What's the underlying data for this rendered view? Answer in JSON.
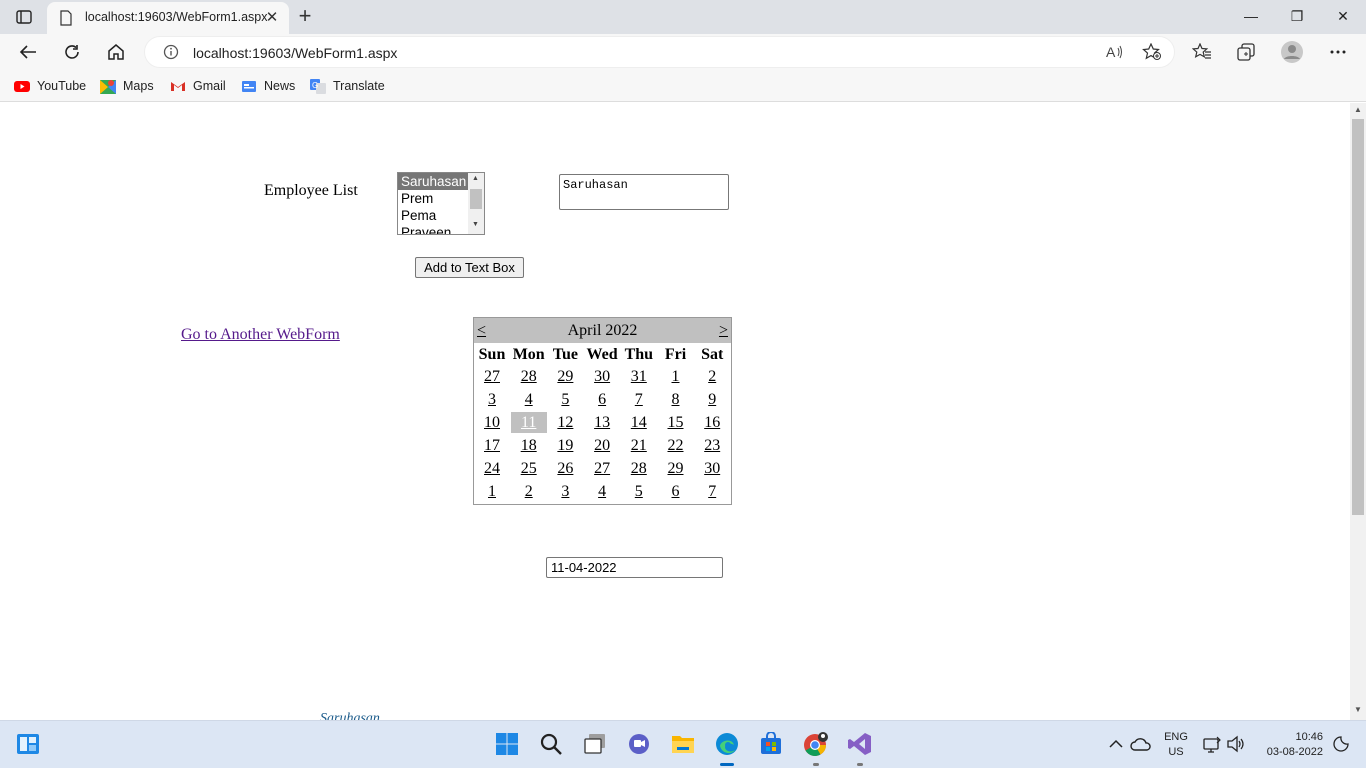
{
  "browser": {
    "tab_title": "localhost:19603/WebForm1.aspx",
    "url": "localhost:19603/WebForm1.aspx",
    "bookmarks": [
      {
        "label": "YouTube",
        "icon": "youtube-icon",
        "color": "#ff0000"
      },
      {
        "label": "Maps",
        "icon": "maps-icon",
        "color": "#34a853"
      },
      {
        "label": "Gmail",
        "icon": "gmail-icon",
        "color": "#d93025"
      },
      {
        "label": "News",
        "icon": "news-icon",
        "color": "#4285f4"
      },
      {
        "label": "Translate",
        "icon": "translate-icon",
        "color": "#4285f4"
      }
    ]
  },
  "page": {
    "employee_label": "Employee List",
    "employees": [
      "Saruhasan",
      "Prem",
      "Pema",
      "Praveen"
    ],
    "selected_employee": "Saruhasan",
    "textarea_value": "Saruhasan",
    "add_button_label": "Add to Text Box",
    "link_text": "Go to Another WebForm",
    "date_value": "11-04-2022",
    "cutoff_text": "Saruhasan"
  },
  "calendar": {
    "prev": "<",
    "next": ">",
    "title": "April 2022",
    "days_of_week": [
      "Sun",
      "Mon",
      "Tue",
      "Wed",
      "Thu",
      "Fri",
      "Sat"
    ],
    "weeks": [
      [
        "27",
        "28",
        "29",
        "30",
        "31",
        "1",
        "2"
      ],
      [
        "3",
        "4",
        "5",
        "6",
        "7",
        "8",
        "9"
      ],
      [
        "10",
        "11",
        "12",
        "13",
        "14",
        "15",
        "16"
      ],
      [
        "17",
        "18",
        "19",
        "20",
        "21",
        "22",
        "23"
      ],
      [
        "24",
        "25",
        "26",
        "27",
        "28",
        "29",
        "30"
      ],
      [
        "1",
        "2",
        "3",
        "4",
        "5",
        "6",
        "7"
      ]
    ],
    "selected": "11"
  },
  "taskbar": {
    "lang_line1": "ENG",
    "lang_line2": "US",
    "time": "10:46",
    "date": "03-08-2022",
    "apps": [
      "start-icon",
      "search-icon",
      "task-view-icon",
      "chat-icon",
      "file-explorer-icon",
      "edge-icon",
      "store-icon",
      "chrome-icon",
      "visual-studio-icon"
    ]
  },
  "colors": {
    "selected_bg": "#767676",
    "calendar_header": "#c0c0c0",
    "link": "#551a8b",
    "taskbar": "#dce6f4"
  }
}
